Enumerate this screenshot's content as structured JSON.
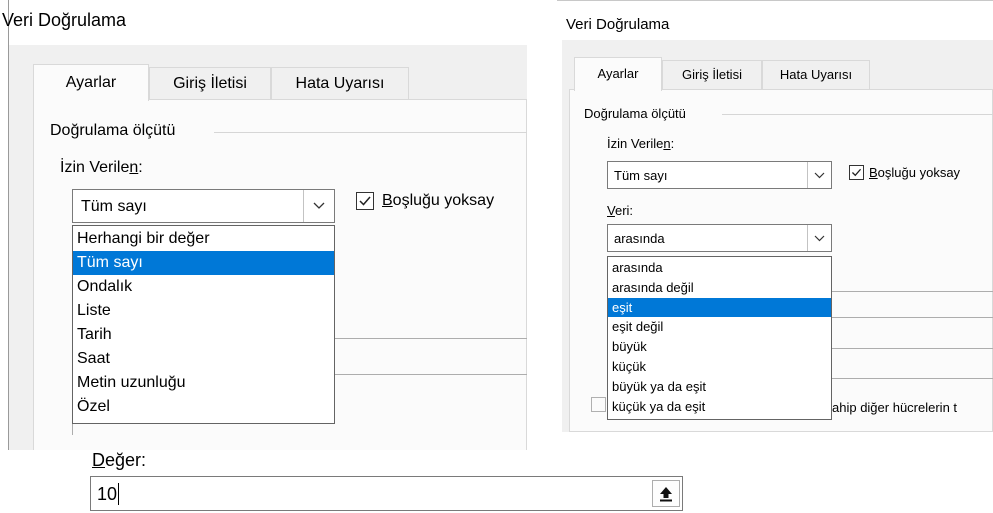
{
  "left_dialog": {
    "title": "Veri Doğrulama",
    "tabs": [
      "Ayarlar",
      "Giriş İletisi",
      "Hata Uyarısı"
    ],
    "group_label": "Doğrulama ölçütü",
    "allow_label_pre": "İzin Verile",
    "allow_label_ul": "n",
    "allow_label_post": ":",
    "allow_value": "Tüm sayı",
    "ignore_blank_ul": "B",
    "ignore_blank_rest": "oşluğu yoksay",
    "ignore_blank_checked": true,
    "dropdown_items": [
      "Herhangi bir değer",
      "Tüm sayı",
      "Ondalık",
      "Liste",
      "Tarih",
      "Saat",
      "Metin uzunluğu",
      "Özel"
    ],
    "dropdown_selected": "Tüm sayı"
  },
  "right_dialog": {
    "title": "Veri Doğrulama",
    "tabs": [
      "Ayarlar",
      "Giriş İletisi",
      "Hata Uyarısı"
    ],
    "group_label": "Doğrulama ölçütü",
    "allow_label_pre": "İzin Verile",
    "allow_label_ul": "n",
    "allow_label_post": ":",
    "allow_value": "Tüm sayı",
    "ignore_blank_ul": "B",
    "ignore_blank_rest": "oşluğu yoksay",
    "ignore_blank_checked": true,
    "data_label_ul": "V",
    "data_label_rest": "eri:",
    "data_value": "arasında",
    "dropdown_items": [
      "arasında",
      "arasında değil",
      "eşit",
      "eşit değil",
      "büyük",
      "küçük",
      "büyük ya da eşit",
      "küçük ya da eşit"
    ],
    "dropdown_selected": "eşit",
    "apply_text_partial": "ahip diğer hücrelerin t"
  },
  "value_field": {
    "label_ul": "D",
    "label_rest": "eğer:",
    "value": "10",
    "button_icon": "collapse-dialog-icon"
  },
  "colors": {
    "selection": "#0078d7",
    "dialog_bg": "#f0f0f0",
    "panel_bg": "#fbfbfb"
  }
}
